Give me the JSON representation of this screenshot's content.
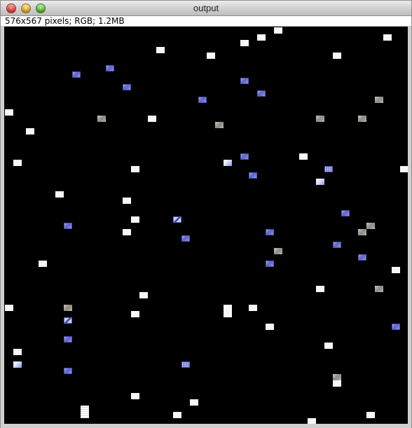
{
  "window": {
    "title": "output",
    "info": "576x567 pixels; RGB; 1.2MB"
  },
  "colors": {
    "canvas_background": "#000000",
    "tile_white": "#f7f7f7",
    "tile_blue": "#6f76d4",
    "tile_gray": "#9d9d95"
  },
  "tiles": [
    {
      "kind": "white"
    },
    {
      "kind": "white"
    },
    {
      "kind": "white"
    },
    {
      "kind": "white"
    },
    {
      "kind": "white"
    },
    {
      "kind": "white"
    },
    {
      "kind": "white"
    },
    {
      "kind": "white"
    },
    {
      "kind": "blue"
    },
    {
      "kind": "blue"
    },
    {
      "kind": "blue"
    },
    {
      "kind": "blue"
    },
    {
      "kind": "blue"
    },
    {
      "kind": "blue"
    },
    {
      "kind": "white"
    },
    {
      "kind": "gray"
    },
    {
      "kind": "white"
    },
    {
      "kind": "gray"
    },
    {
      "kind": "gray"
    },
    {
      "kind": "gray"
    },
    {
      "kind": "gray"
    },
    {
      "kind": "white"
    },
    {
      "kind": "white"
    },
    {
      "kind": "white"
    },
    {
      "kind": "white"
    },
    {
      "kind": "lightblue"
    },
    {
      "kind": "blue"
    },
    {
      "kind": "white"
    },
    {
      "kind": "blue"
    },
    {
      "kind": "white"
    },
    {
      "kind": "grid"
    },
    {
      "kind": "lightblue"
    },
    {
      "kind": "blue"
    },
    {
      "kind": "white"
    },
    {
      "kind": "blue"
    },
    {
      "kind": "white"
    },
    {
      "kind": "diag"
    },
    {
      "kind": "blue"
    },
    {
      "kind": "gray"
    },
    {
      "kind": "blue"
    },
    {
      "kind": "white"
    },
    {
      "kind": "white"
    },
    {
      "kind": "gray"
    },
    {
      "kind": "blue"
    },
    {
      "kind": "gray"
    },
    {
      "kind": "blue"
    },
    {
      "kind": "white"
    },
    {
      "kind": "gray"
    },
    {
      "kind": "white"
    },
    {
      "kind": "blue"
    },
    {
      "kind": "white"
    },
    {
      "kind": "white"
    },
    {
      "kind": "gray"
    },
    {
      "kind": "white"
    },
    {
      "kind": "white"
    },
    {
      "kind": "diag"
    },
    {
      "kind": "white"
    },
    {
      "kind": "lightblue"
    },
    {
      "kind": "blue"
    },
    {
      "kind": "white"
    },
    {
      "kind": "blue"
    },
    {
      "kind": "grid"
    },
    {
      "kind": "white"
    },
    {
      "kind": "white"
    },
    {
      "kind": "white"
    },
    {
      "kind": "blue"
    },
    {
      "kind": "gray"
    },
    {
      "kind": "tall"
    },
    {
      "kind": "white"
    },
    {
      "kind": "white"
    },
    {
      "kind": "white"
    },
    {
      "kind": "white"
    },
    {
      "kind": "white"
    },
    {
      "kind": "white"
    }
  ]
}
